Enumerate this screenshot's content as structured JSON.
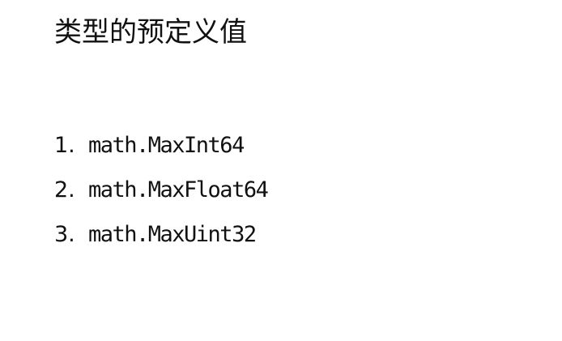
{
  "slide": {
    "title": "类型的预定义值",
    "items": [
      {
        "number": "1.",
        "text": "math.MaxInt64"
      },
      {
        "number": "2.",
        "text": "math.MaxFloat64"
      },
      {
        "number": "3.",
        "text": "math.MaxUint32"
      }
    ]
  }
}
